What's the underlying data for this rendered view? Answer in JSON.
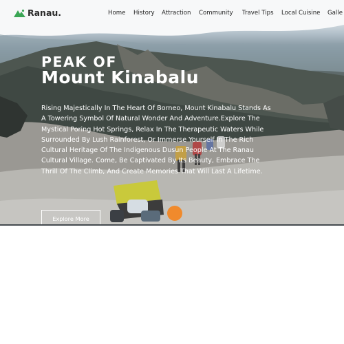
{
  "brand": {
    "name": "Ranau."
  },
  "nav": {
    "items": [
      "Home",
      "History",
      "Attraction",
      "Community",
      "Travel Tips",
      "Local Cuisine",
      "Galle"
    ]
  },
  "hero": {
    "title_small": "PEAK OF",
    "title_big": "Mount Kinabalu",
    "description": "Rising Majestically In The Heart Of Borneo, Mount Kinabalu Stands As A Towering Symbol Of Natural Wonder And Adventure.Explore The Mystical Poring Hot Springs, Relax In The Therapeutic Waters While Surrounded By Lush Rainforest, Or Immerse Yourself In The Rich Cultural Heritage Of The Indigenous Dusun People At The Ranau Cultural Village. Come, Be Captivated By Its Beauty, Embrace The Thrill Of The Climb, And Create Memories That Will Last A Lifetime.",
    "cta_label": "Explore More"
  },
  "colors": {
    "brand_green": "#3aa655",
    "text_dark": "#1f1f1f"
  },
  "icons": {
    "logo": "mountain-icon"
  }
}
